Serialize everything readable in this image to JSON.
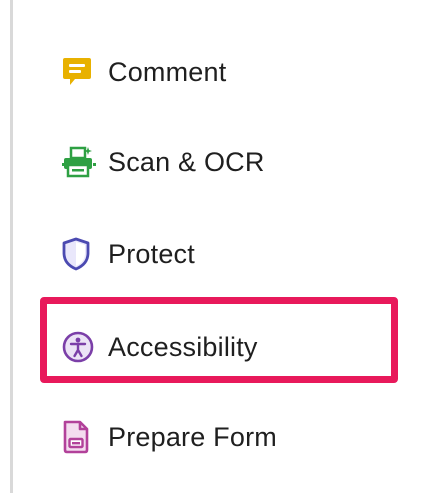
{
  "tools_panel": {
    "items": [
      {
        "label": "Comment",
        "icon": "comment-icon",
        "icon_color": "#e8b100"
      },
      {
        "label": "Scan & OCR",
        "icon": "scan-ocr-icon",
        "icon_color": "#2ea043"
      },
      {
        "label": "Protect",
        "icon": "shield-icon",
        "icon_color": "#4b4ab1"
      },
      {
        "label": "Accessibility",
        "icon": "accessibility-icon",
        "icon_color": "#7b3fa8"
      },
      {
        "label": "Prepare Form",
        "icon": "prepare-form-icon",
        "icon_color": "#b2419a"
      }
    ],
    "highlighted_item": "Accessibility",
    "highlight_color": "#e8195b"
  }
}
